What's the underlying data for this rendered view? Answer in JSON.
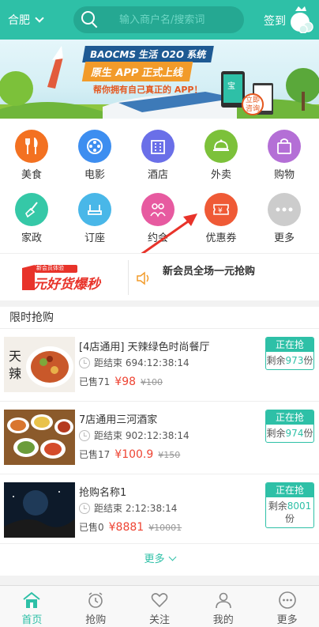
{
  "header": {
    "city": "合肥",
    "search_placeholder": "输入商户名/搜索词",
    "signin": "签到"
  },
  "banner": {
    "title": "BAOCMS 生活 O2O 系统",
    "subtitle": "原生 APP 正式上线",
    "tag": "帮你拥有自己真正的 APP！",
    "badge": "立即咨询"
  },
  "categories": [
    {
      "label": "美食",
      "icon": "fork-knife-icon",
      "color": "#f37121"
    },
    {
      "label": "电影",
      "icon": "film-reel-icon",
      "color": "#3d8ef0"
    },
    {
      "label": "酒店",
      "icon": "building-icon",
      "color": "#6a6fe8"
    },
    {
      "label": "外卖",
      "icon": "food-cover-icon",
      "color": "#7cc13a"
    },
    {
      "label": "购物",
      "icon": "shopping-bag-icon",
      "color": "#b46fd6"
    },
    {
      "label": "家政",
      "icon": "broom-icon",
      "color": "#35c8a7"
    },
    {
      "label": "订座",
      "icon": "seat-icon",
      "color": "#49b7e8"
    },
    {
      "label": "约会",
      "icon": "dating-icon",
      "color": "#e75aa0"
    },
    {
      "label": "优惠券",
      "icon": "coupon-icon",
      "color": "#ef5a36"
    },
    {
      "label": "更多",
      "icon": "more-dots-icon",
      "color": "#cccccc"
    }
  ],
  "promo": {
    "badge": "新会员体验",
    "slogan": "1元好货爆秒",
    "text": "新会员全场一元抢购"
  },
  "flash_sale": {
    "heading": "限时抢购",
    "items": [
      {
        "title": "[4店通用] 天辣绿色时尚餐厅",
        "countdown": "距结束 694:12:38:14",
        "sold": "已售71",
        "price": "¥98",
        "old_price": "¥100",
        "status": "正在抢",
        "remaining_prefix": "剩余",
        "remaining": "973",
        "remaining_suffix": "份"
      },
      {
        "title": "7店通用三河酒家",
        "countdown": "距结束 902:12:38:14",
        "sold": "已售17",
        "price": "¥100.9",
        "old_price": "¥150",
        "status": "正在抢",
        "remaining_prefix": "剩余",
        "remaining": "974",
        "remaining_suffix": "份"
      },
      {
        "title": "抢购名称1",
        "countdown": "距结束 2:12:38:14",
        "sold": "已售0",
        "price": "¥8881",
        "old_price": "¥10001",
        "status": "正在抢",
        "remaining_prefix": "剩余",
        "remaining": "8001",
        "remaining_suffix": "份"
      }
    ],
    "more": "更多"
  },
  "tabbar": [
    {
      "label": "首页",
      "icon": "home-icon",
      "active": true
    },
    {
      "label": "抢购",
      "icon": "alarm-clock-icon",
      "active": false
    },
    {
      "label": "关注",
      "icon": "heart-icon",
      "active": false
    },
    {
      "label": "我的",
      "icon": "user-icon",
      "active": false
    },
    {
      "label": "更多",
      "icon": "more-dots-icon",
      "active": false
    }
  ]
}
